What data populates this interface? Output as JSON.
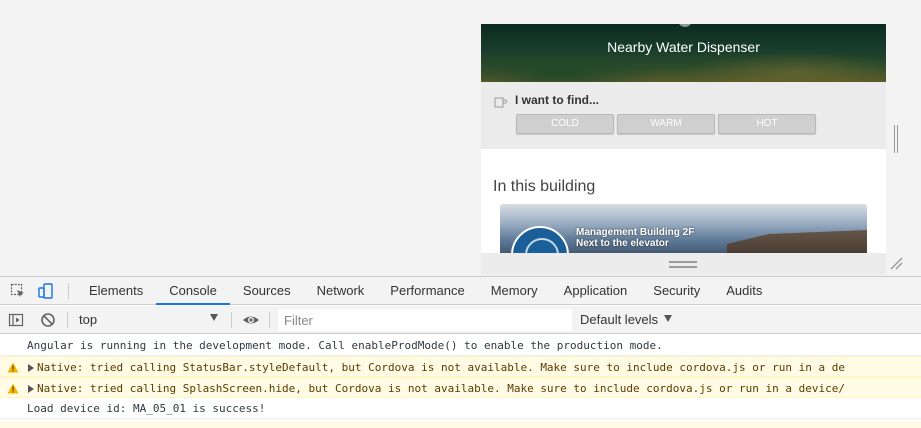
{
  "device": {
    "hero_title": "Nearby Water Dispenser",
    "finder_label": "I want to find...",
    "chips": [
      "COLD",
      "WARM",
      "HOT"
    ],
    "section_title": "In this building",
    "card": {
      "line1": "Management Building 2F",
      "line2": "Next to the elevator"
    }
  },
  "devtools": {
    "tabs": [
      "Elements",
      "Console",
      "Sources",
      "Network",
      "Performance",
      "Memory",
      "Application",
      "Security",
      "Audits"
    ],
    "active_tab": "Console",
    "context": "top",
    "filter_placeholder": "Filter",
    "levels": "Default levels",
    "accent_color": "#1a73e8",
    "warning_bg": "#fffbe5",
    "logs": [
      {
        "level": "info",
        "text": "Angular is running in the development mode. Call enableProdMode() to enable the production mode."
      },
      {
        "level": "warning",
        "text": "Native: tried calling StatusBar.styleDefault, but Cordova is not available. Make sure to include cordova.js or run in a de"
      },
      {
        "level": "warning",
        "text": "Native: tried calling SplashScreen.hide, but Cordova is not available. Make sure to include cordova.js or run in a device/"
      },
      {
        "level": "info",
        "text": "Load device id: MA_05_01 is success!"
      }
    ]
  }
}
